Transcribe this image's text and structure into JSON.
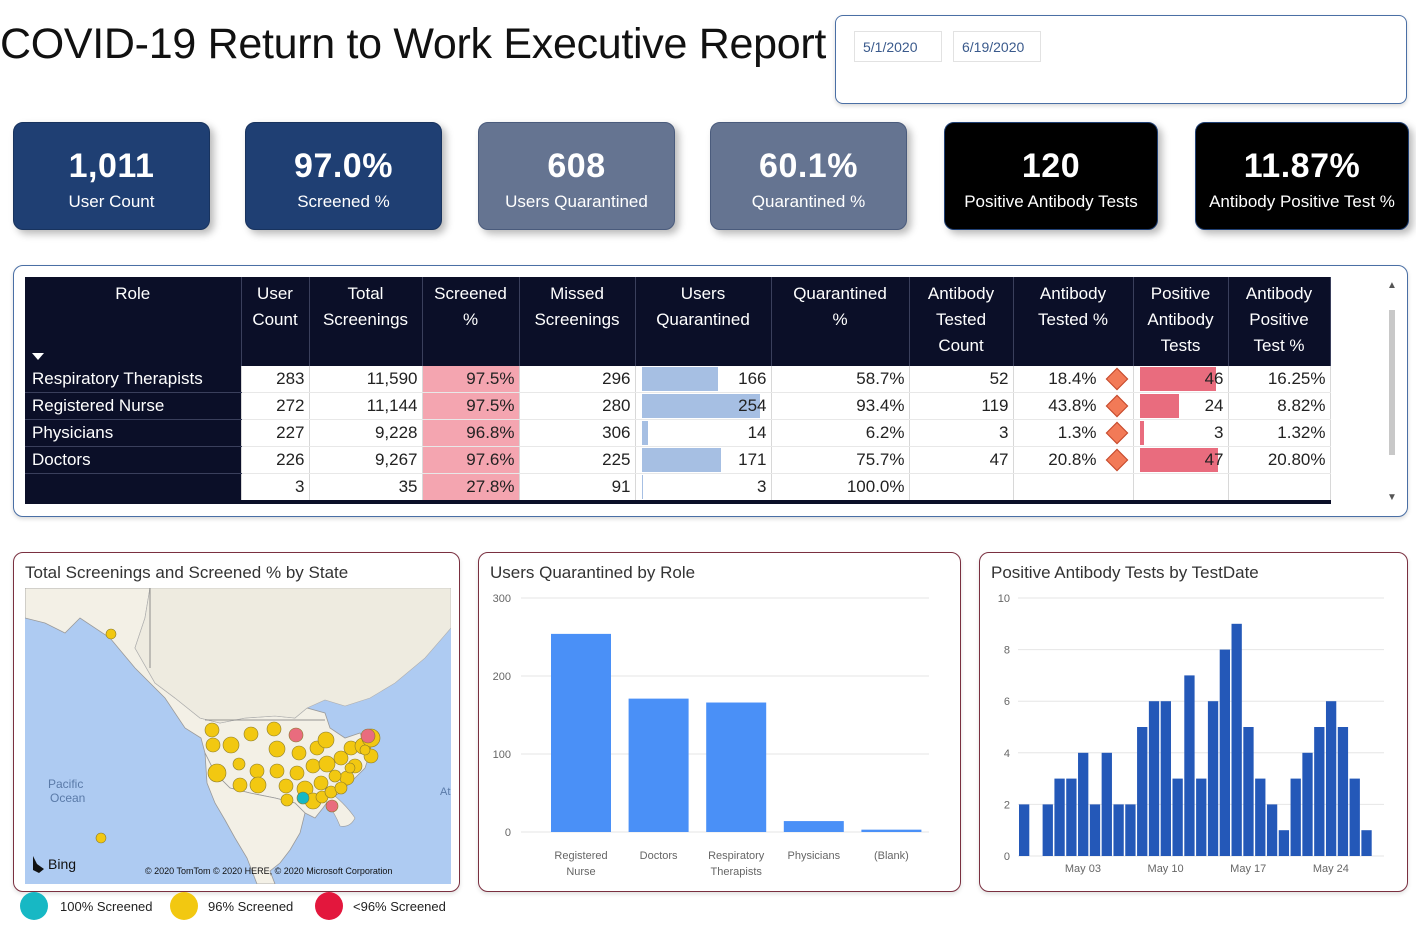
{
  "title": "COVID-19 Return to Work Executive Report",
  "date_range": {
    "start": "5/1/2020",
    "end": "6/19/2020"
  },
  "kpis": [
    {
      "value": "1,011",
      "label": "User Count"
    },
    {
      "value": "97.0%",
      "label": "Screened %"
    },
    {
      "value": "608",
      "label": "Users Quarantined"
    },
    {
      "value": "60.1%",
      "label": "Quarantined %"
    },
    {
      "value": "120",
      "label": "Positive Antibody Tests"
    },
    {
      "value": "11.87%",
      "label": "Antibody Positive Test %"
    }
  ],
  "table": {
    "headers": {
      "role": "Role",
      "user_count": [
        "User",
        "Count"
      ],
      "total_screenings": [
        "Total",
        "Screenings"
      ],
      "screened_pct": [
        "Screened",
        "%"
      ],
      "missed": [
        "Missed",
        "Screenings"
      ],
      "quarantined": [
        "Users",
        "Quarantined"
      ],
      "quarantined_pct": [
        "Quarantined",
        "%"
      ],
      "ab_tested_count": [
        "Antibody",
        "Tested",
        "Count"
      ],
      "ab_tested_pct": [
        "Antibody",
        "Tested %"
      ],
      "positive_ab": [
        "Positive",
        "Antibody",
        "Tests"
      ],
      "ab_positive_pct": [
        "Antibody",
        "Positive",
        "Test %"
      ]
    },
    "rows": [
      {
        "role": "Respiratory Therapists",
        "user_count": "283",
        "total_screenings": "11,590",
        "screened_pct": "97.5%",
        "missed": "296",
        "quarantined": "166",
        "quarantined_fill": 0.65,
        "quarantined_pct": "58.7%",
        "ab_tested_count": "52",
        "ab_tested_pct": "18.4%",
        "positive_ab": "46",
        "positive_fill": 0.98,
        "ab_positive_pct": "16.25%"
      },
      {
        "role": "Registered Nurse",
        "user_count": "272",
        "total_screenings": "11,144",
        "screened_pct": "97.5%",
        "missed": "280",
        "quarantined": "254",
        "quarantined_fill": 1.0,
        "quarantined_pct": "93.4%",
        "ab_tested_count": "119",
        "ab_tested_pct": "43.8%",
        "positive_ab": "24",
        "positive_fill": 0.51,
        "ab_positive_pct": "8.82%"
      },
      {
        "role": "Physicians",
        "user_count": "227",
        "total_screenings": "9,228",
        "screened_pct": "96.8%",
        "missed": "306",
        "quarantined": "14",
        "quarantined_fill": 0.055,
        "quarantined_pct": "6.2%",
        "ab_tested_count": "3",
        "ab_tested_pct": "1.3%",
        "positive_ab": "3",
        "positive_fill": 0.064,
        "ab_positive_pct": "1.32%"
      },
      {
        "role": "Doctors",
        "user_count": "226",
        "total_screenings": "9,267",
        "screened_pct": "97.6%",
        "missed": "225",
        "quarantined": "171",
        "quarantined_fill": 0.67,
        "quarantined_pct": "75.7%",
        "ab_tested_count": "47",
        "ab_tested_pct": "20.8%",
        "positive_ab": "47",
        "positive_fill": 1.0,
        "ab_positive_pct": "20.80%"
      },
      {
        "role": "",
        "user_count": "3",
        "total_screenings": "35",
        "screened_pct": "27.8%",
        "missed": "91",
        "quarantined": "3",
        "quarantined_fill": 0.012,
        "quarantined_pct": "100.0%",
        "ab_tested_count": "",
        "ab_tested_pct": "",
        "positive_ab": "",
        "positive_fill": 0,
        "ab_positive_pct": ""
      }
    ]
  },
  "map_panel": {
    "title": "Total Screenings and Screened % by State",
    "ocean_label_1": "Pacific",
    "ocean_label_2": "Ocean",
    "atlantic_label": "At",
    "bing": "Bing",
    "copyright": "© 2020 TomTom © 2020 HERE, © 2020 Microsoft Corporation"
  },
  "legend": [
    {
      "label": "100% Screened",
      "color": "#17b8c4"
    },
    {
      "label": "96% Screened",
      "color": "#f2c811"
    },
    {
      "label": "<96% Screened",
      "color": "#e3173d"
    }
  ],
  "chart_data": [
    {
      "type": "bar",
      "title": "Users Quarantined by Role",
      "categories": [
        "Registered Nurse",
        "Doctors",
        "Respiratory Therapists",
        "Physicians",
        "(Blank)"
      ],
      "category_lines": [
        [
          "Registered",
          "Nurse"
        ],
        [
          "Doctors"
        ],
        [
          "Respiratory",
          "Therapists"
        ],
        [
          "Physicians"
        ],
        [
          "(Blank)"
        ]
      ],
      "values": [
        254,
        171,
        166,
        14,
        3
      ],
      "ylim": [
        0,
        300
      ],
      "yticks": [
        "0",
        "100",
        "200",
        "300"
      ],
      "color": "#4a90f7",
      "grid": true
    },
    {
      "type": "bar",
      "title": "Positive Antibody Tests by TestDate",
      "x": [
        "Apr 28",
        "Apr 29",
        "Apr 30",
        "May 01",
        "May 02",
        "May 03",
        "May 04",
        "May 05",
        "May 06",
        "May 07",
        "May 08",
        "May 09",
        "May 10",
        "May 11",
        "May 12",
        "May 13",
        "May 14",
        "May 15",
        "May 16",
        "May 17",
        "May 18",
        "May 19",
        "May 20",
        "May 21",
        "May 22",
        "May 23",
        "May 24",
        "May 25",
        "May 26",
        "May 27",
        "May 28"
      ],
      "values": [
        2,
        0,
        2,
        3,
        3,
        4,
        2,
        4,
        2,
        2,
        5,
        6,
        6,
        3,
        7,
        3,
        6,
        8,
        9,
        5,
        3,
        2,
        1,
        3,
        4,
        5,
        6,
        5,
        3,
        1,
        0
      ],
      "xtick_labels": [
        "May 03",
        "May 10",
        "May 17",
        "May 24"
      ],
      "ylim": [
        0,
        10
      ],
      "yticks": [
        "0",
        "2",
        "4",
        "6",
        "8",
        "10"
      ],
      "color": "#2458b8",
      "grid": true
    }
  ]
}
